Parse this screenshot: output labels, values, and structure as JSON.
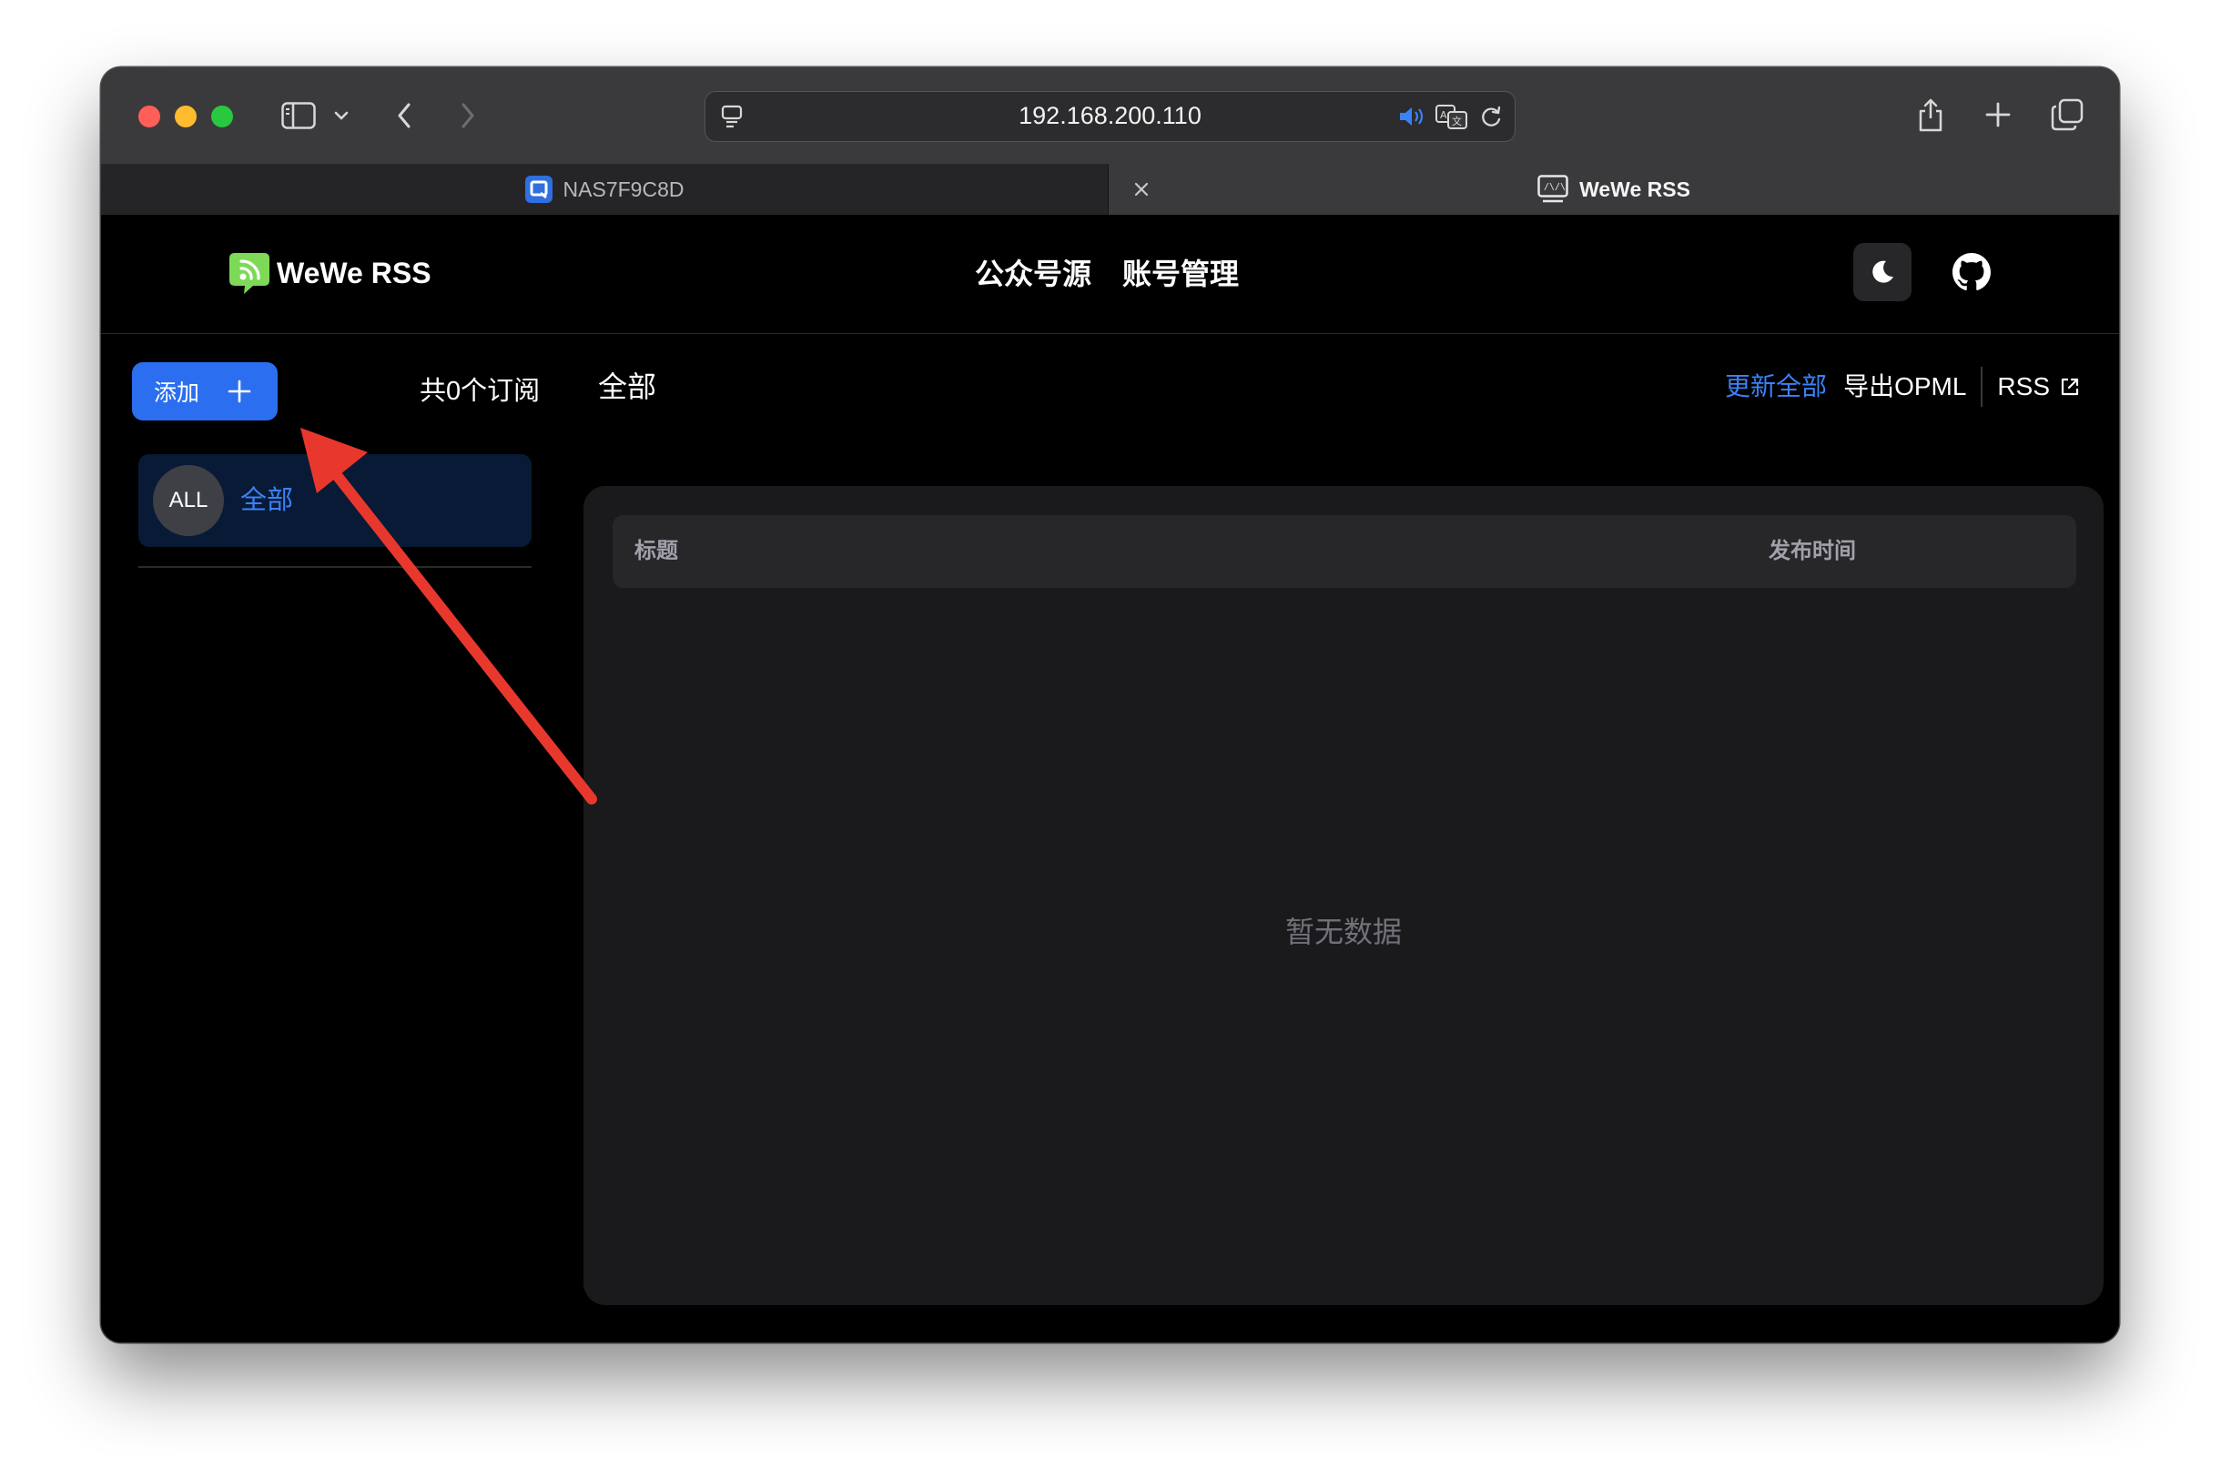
{
  "browser": {
    "url": "192.168.200.110",
    "tabs": [
      {
        "label": "NAS7F9C8D",
        "active": false
      },
      {
        "label": "WeWe RSS",
        "active": true
      }
    ]
  },
  "app": {
    "brand": "WeWe RSS",
    "nav": [
      "公众号源",
      "账号管理"
    ]
  },
  "sidebar": {
    "add_label": "添加",
    "subscription_count": "共0个订阅",
    "feeds": [
      {
        "avatar": "ALL",
        "name": "全部"
      }
    ]
  },
  "main": {
    "title": "全部",
    "actions": {
      "update_all": "更新全部",
      "export_opml": "导出OPML",
      "rss": "RSS"
    },
    "table": {
      "columns": [
        "标题",
        "发布时间"
      ],
      "rows": [],
      "empty_text": "暂无数据"
    }
  },
  "colors": {
    "accent": "#2b6ff0",
    "link": "#3b82f6",
    "annotation": "#e8382d"
  }
}
